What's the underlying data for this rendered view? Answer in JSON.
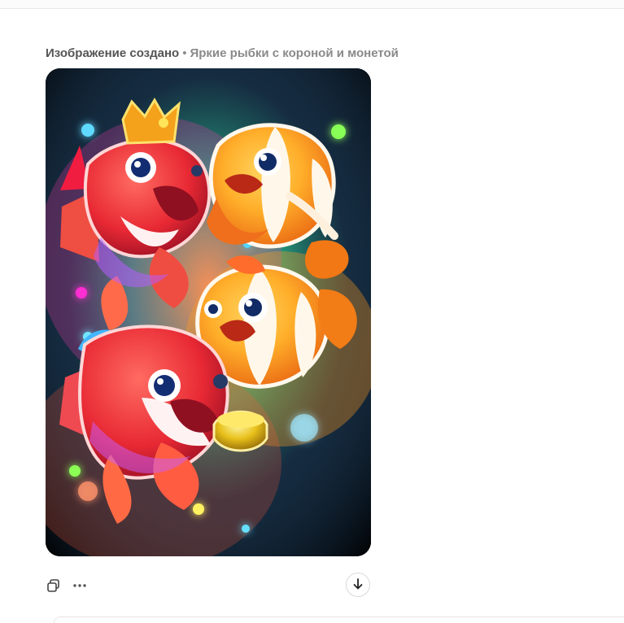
{
  "message": {
    "caption_strong": "Изображение создано",
    "caption_separator": "•",
    "caption_description": "Яркие рыбки с короной и монетой"
  },
  "image": {
    "alt": "Яркие рыбки с короной и монетой"
  },
  "actions": {
    "copy_icon": "copy-icon",
    "more_icon": "more-icon",
    "download_icon": "download-icon"
  }
}
